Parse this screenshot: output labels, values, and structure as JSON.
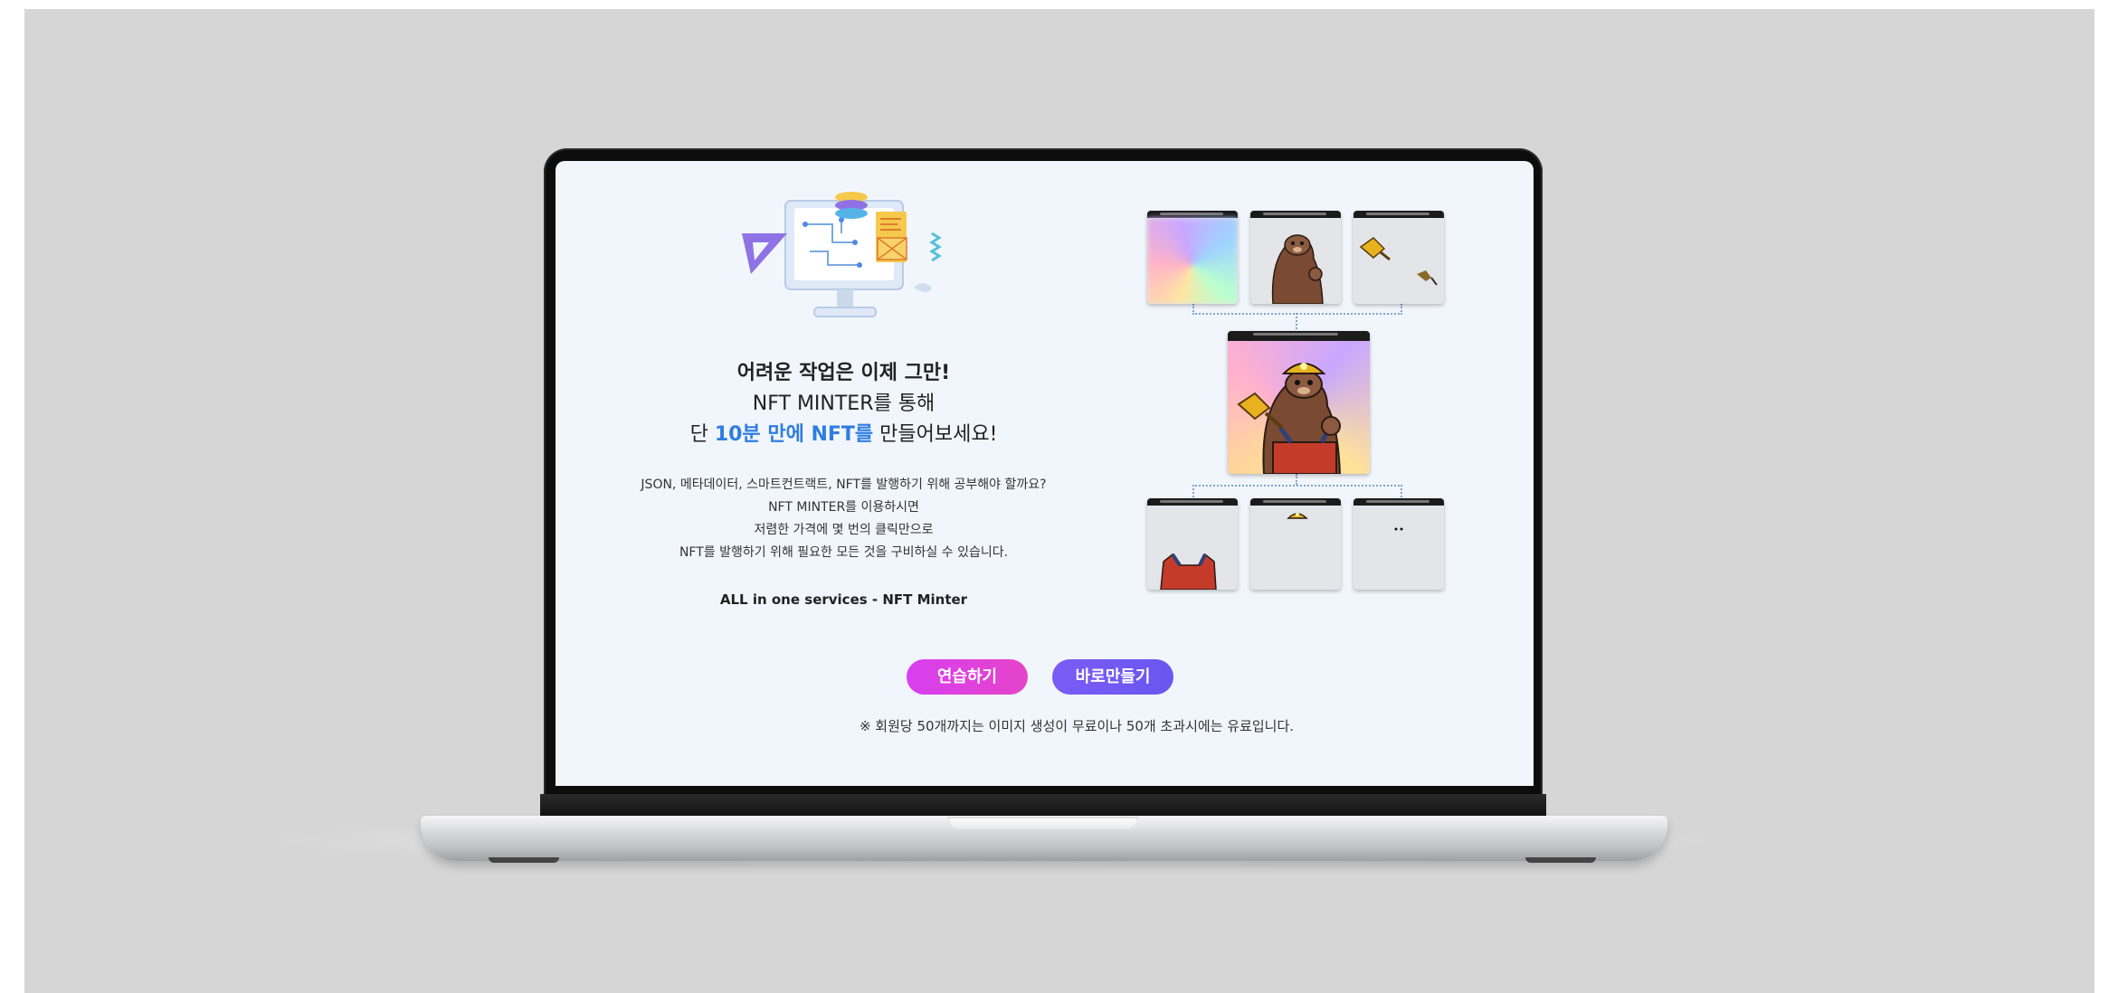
{
  "hero": {
    "headline_line1": "어려운 작업은 이제 그만!",
    "headline_line2": "NFT MINTER를 통해",
    "headline_line3_prefix": "단 ",
    "headline_line3_accent": "10분 만에 NFT를",
    "headline_line3_suffix": " 만들어보세요!"
  },
  "description": [
    "JSON, 메타데이터, 스마트컨트랙트, NFT를 발행하기 위해 공부해야 할까요?",
    "NFT MINTER를 이용하시면",
    "저렴한 가격에 몇 번의 클릭만으로",
    "NFT를 발행하기 위해 필요한 모든 것을 구비하실 수 있습니다."
  ],
  "tagline": "ALL in one services - NFT Minter",
  "buttons": {
    "practice": "연습하기",
    "make_now": "바로만들기"
  },
  "notice": "※ 회원당 50개까지는 이미지 생성이 무료이나 50개 초과시에는 유료입니다.",
  "colors": {
    "accent_blue": "#2f7de1",
    "practice_button": "#dd40e0",
    "make_button": "#7158f2",
    "screen_bg": "#f1f6fc",
    "backdrop": "#d6d6d6"
  },
  "icons": {
    "illustration": "computer-layers-illustration-icon",
    "layer_cards": [
      "gradient-background-layer",
      "otter-body-layer",
      "shovel-accessory-layer",
      "composite-nft-otter",
      "overalls-layer",
      "helmet-layer",
      "eyes-layer"
    ]
  }
}
